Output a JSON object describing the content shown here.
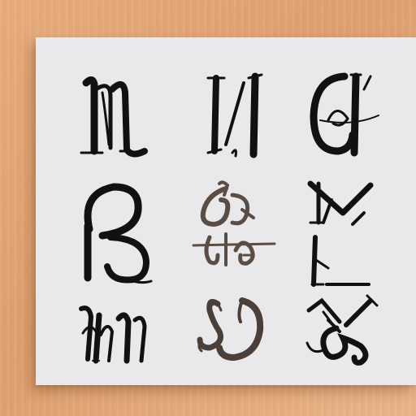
{
  "background": {
    "color": "#e4a675"
  },
  "card": {
    "color": "#e9e9eb"
  },
  "glyphs": [
    {
      "name": "glyph-m-blackletter",
      "ink": "#111111"
    },
    {
      "name": "glyph-n-italic",
      "ink": "#111111"
    },
    {
      "name": "glyph-a-loop",
      "ink": "#111111"
    },
    {
      "name": "glyph-b-round",
      "ink": "#111111"
    },
    {
      "name": "glyph-ornament-flourish",
      "ink": "#5a4d45"
    },
    {
      "name": "glyph-n-zigzag",
      "ink": "#111111"
    },
    {
      "name": "glyph-w-swash",
      "ink": "#111111"
    },
    {
      "name": "glyph-s-curl",
      "ink": "#4a3f39"
    },
    {
      "name": "glyph-x-loop",
      "ink": "#111111"
    }
  ]
}
